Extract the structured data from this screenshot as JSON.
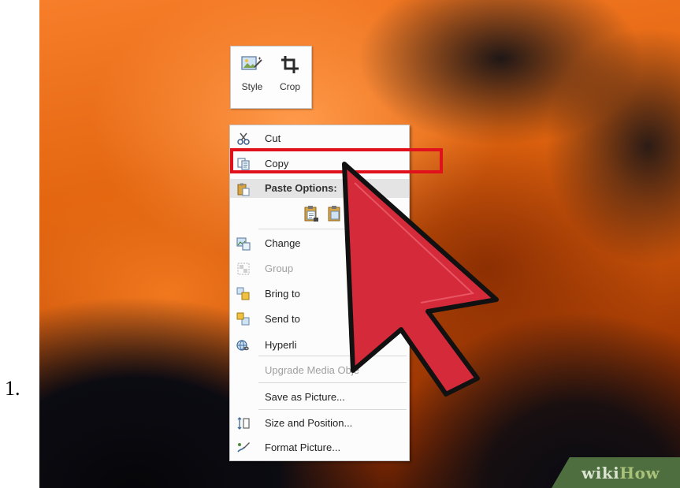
{
  "step": {
    "number": "1."
  },
  "mini_toolbar": {
    "buttons": [
      {
        "label": "Style",
        "icon": "picture-style-icon"
      },
      {
        "label": "Crop",
        "icon": "crop-icon"
      }
    ]
  },
  "context_menu": {
    "items": {
      "cut": {
        "label": "Cut",
        "icon": "scissors-icon",
        "enabled": true
      },
      "copy": {
        "label": "Copy",
        "icon": "copy-icon",
        "enabled": true,
        "highlighted": true
      },
      "paste_options": {
        "label": "Paste Options:",
        "icon": "paste-icon"
      },
      "change_picture": {
        "label": "Change",
        "icon": "change-picture-icon",
        "enabled": true
      },
      "group": {
        "label": "Group",
        "icon": "group-icon",
        "enabled": false
      },
      "bring_to_front": {
        "label": "Bring to",
        "icon": "bring-to-front-icon",
        "enabled": true
      },
      "send_to_back": {
        "label": "Send to",
        "icon": "send-to-back-icon",
        "enabled": true
      },
      "hyperlink": {
        "label": "Hyperli",
        "icon": "hyperlink-icon",
        "enabled": true
      },
      "upgrade_media": {
        "label": "Upgrade Media Obje",
        "enabled": false
      },
      "save_as_picture": {
        "label": "Save as Picture...",
        "enabled": true
      },
      "size_position": {
        "label": "Size and Position...",
        "icon": "size-position-icon",
        "enabled": true
      },
      "format_picture": {
        "label": "Format Picture...",
        "icon": "format-picture-icon",
        "enabled": true
      }
    }
  },
  "colors": {
    "highlight_border": "#e0101c",
    "cursor_fill": "#d42a3a",
    "cursor_outline": "#111111"
  },
  "watermark": {
    "part1": "wiki",
    "part2": "How"
  }
}
